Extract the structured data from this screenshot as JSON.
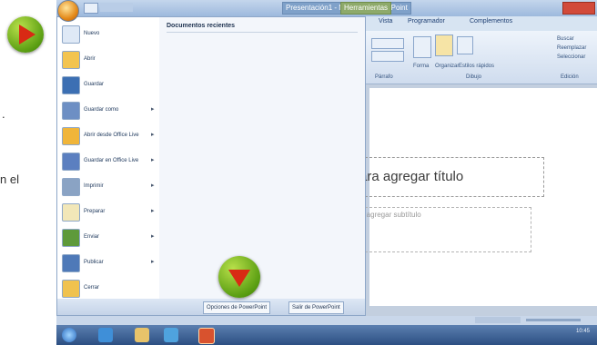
{
  "margin_text": {
    "dot": ".",
    "el": "n el"
  },
  "window": {
    "title_segments": [
      "Presentación1 - Microsoft PowerPoint",
      "Herramientas"
    ]
  },
  "ribbon": {
    "tabs": [
      "Vista",
      "Programador",
      "Complementos"
    ],
    "labels": [
      "Forma",
      "Organizar",
      "Estilos rápidos",
      "Buscar",
      "Reemplazar",
      "Seleccionar"
    ],
    "groups": [
      "Párrafo",
      "Dibujo",
      "Edición"
    ]
  },
  "office_menu": {
    "commands": [
      {
        "label": "Nuevo",
        "has_submenu": false,
        "icon": "new-document-icon"
      },
      {
        "label": "Abrir",
        "has_submenu": false,
        "icon": "open-folder-icon"
      },
      {
        "label": "Guardar",
        "has_submenu": false,
        "icon": "save-disk-icon"
      },
      {
        "label": "Guardar como",
        "has_submenu": true,
        "icon": "save-as-icon"
      },
      {
        "label": "Abrir desde Office Live",
        "has_submenu": true,
        "icon": "open-live-icon"
      },
      {
        "label": "Guardar en Office Live",
        "has_submenu": true,
        "icon": "save-live-icon"
      },
      {
        "label": "Imprimir",
        "has_submenu": true,
        "icon": "print-icon"
      },
      {
        "label": "Preparar",
        "has_submenu": true,
        "icon": "prepare-icon"
      },
      {
        "label": "Enviar",
        "has_submenu": true,
        "icon": "send-icon"
      },
      {
        "label": "Publicar",
        "has_submenu": true,
        "icon": "publish-icon"
      },
      {
        "label": "Cerrar",
        "has_submenu": false,
        "icon": "close-folder-icon"
      }
    ],
    "recent_header": "Documentos recientes",
    "footer": {
      "options": "Opciones de PowerPoint",
      "exit": "Salir de PowerPoint"
    }
  },
  "slide": {
    "title_placeholder": "ara agregar título",
    "subtitle_placeholder": "o agregar subtítulo"
  },
  "taskbar": {
    "clock": "10:45"
  },
  "colors": {
    "accent_green": "#5a9e12",
    "marker_red": "#d82a14"
  }
}
